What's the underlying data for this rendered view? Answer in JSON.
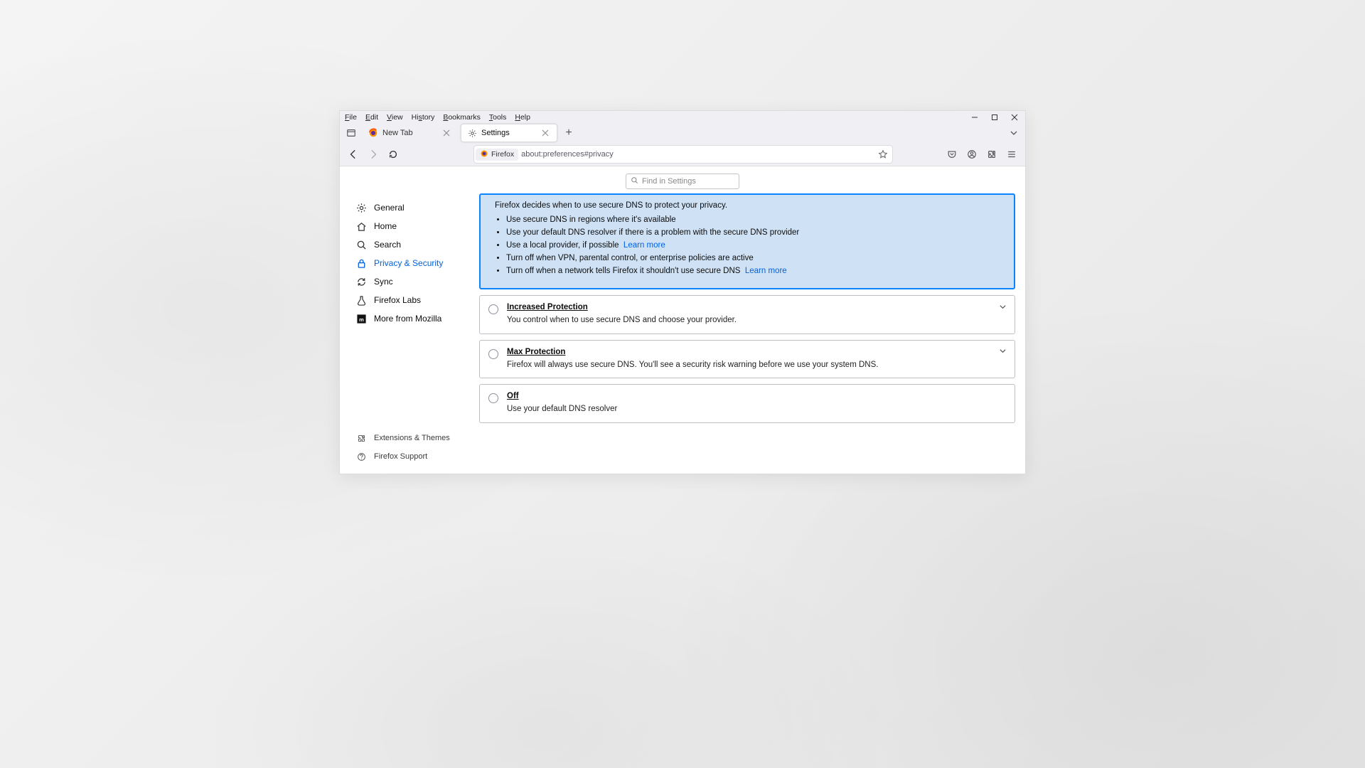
{
  "menubar": {
    "file": "File",
    "edit": "Edit",
    "view": "View",
    "history": "History",
    "bookmarks": "Bookmarks",
    "tools": "Tools",
    "help": "Help"
  },
  "tabs": {
    "newtab_label": "New Tab",
    "settings_label": "Settings"
  },
  "urlbar": {
    "badge_label": "Firefox",
    "url": "about:preferences#privacy"
  },
  "search": {
    "placeholder": "Find in Settings"
  },
  "sidebar": {
    "items": {
      "general": "General",
      "home": "Home",
      "search": "Search",
      "privacy": "Privacy & Security",
      "sync": "Sync",
      "labs": "Firefox Labs",
      "mozilla": "More from Mozilla"
    },
    "footer": {
      "extensions": "Extensions & Themes",
      "support": "Firefox Support"
    }
  },
  "dns": {
    "selected_lead": "Firefox decides when to use secure DNS to protect your privacy.",
    "bullets": [
      "Use secure DNS in regions where it's available",
      "Use your default DNS resolver if there is a problem with the secure DNS provider",
      "Use a local provider, if possible",
      "Turn off when VPN, parental control, or enterprise policies are active",
      "Turn off when a network tells Firefox it shouldn't use secure DNS"
    ],
    "learn_more": "Learn more",
    "increased": {
      "title": "Increased Protection",
      "desc": "You control when to use secure DNS and choose your provider."
    },
    "max": {
      "title": "Max Protection",
      "desc": "Firefox will always use secure DNS. You'll see a security risk warning before we use your system DNS."
    },
    "off": {
      "title": "Off",
      "desc": "Use your default DNS resolver"
    }
  },
  "colors": {
    "accent": "#0060df",
    "selection_bg": "#cfe2f5",
    "selection_border": "#0a84ff"
  }
}
